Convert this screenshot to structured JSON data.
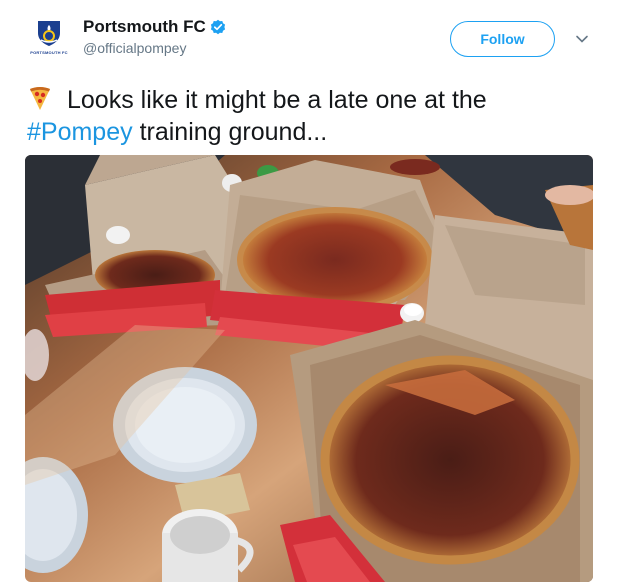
{
  "account": {
    "name": "Portsmouth FC",
    "handle": "@officialpompey",
    "avatar_text": "PORTSMOUTH FC",
    "verified": true
  },
  "follow_label": "Follow",
  "tweet": {
    "emoji": "pizza-icon",
    "text_before": "Looks like it might be a late one at the",
    "hashtag": "#Pompey",
    "text_after": " training ground..."
  },
  "colors": {
    "brand_blue": "#1da1f2",
    "hashtag_blue": "#1b95e0",
    "handle_grey": "#657786"
  }
}
